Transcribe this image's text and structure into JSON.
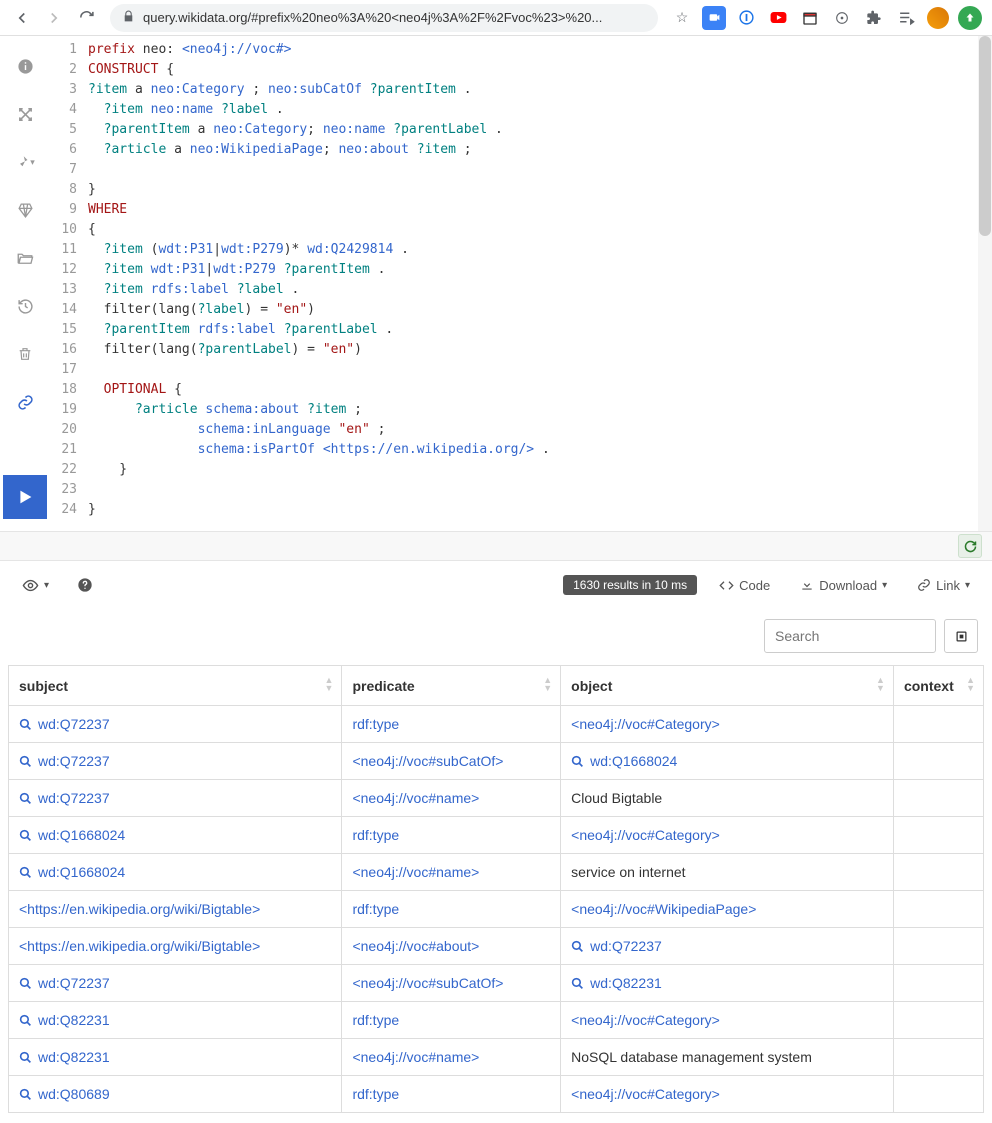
{
  "browser": {
    "url": "query.wikidata.org/#prefix%20neo%3A%20<neo4j%3A%2F%2Fvoc%23>%20..."
  },
  "editor": {
    "lines": [
      {
        "n": 1,
        "tokens": [
          [
            "kw",
            "prefix "
          ],
          [
            "plain",
            "neo: "
          ],
          [
            "uri",
            "<neo4j://voc#>"
          ]
        ]
      },
      {
        "n": 2,
        "tokens": [
          [
            "kw",
            "CONSTRUCT"
          ],
          [
            "plain",
            " {"
          ]
        ]
      },
      {
        "n": 3,
        "tokens": [
          [
            "var",
            "?item"
          ],
          [
            "plain",
            " a "
          ],
          [
            "uri",
            "neo:Category"
          ],
          [
            "plain",
            " ; "
          ],
          [
            "uri",
            "neo:subCatOf"
          ],
          [
            "plain",
            " "
          ],
          [
            "var",
            "?parentItem"
          ],
          [
            "plain",
            " ."
          ]
        ]
      },
      {
        "n": 4,
        "tokens": [
          [
            "plain",
            "  "
          ],
          [
            "var",
            "?item"
          ],
          [
            "plain",
            " "
          ],
          [
            "uri",
            "neo:name"
          ],
          [
            "plain",
            " "
          ],
          [
            "var",
            "?label"
          ],
          [
            "plain",
            " ."
          ]
        ]
      },
      {
        "n": 5,
        "tokens": [
          [
            "plain",
            "  "
          ],
          [
            "var",
            "?parentItem"
          ],
          [
            "plain",
            " a "
          ],
          [
            "uri",
            "neo:Category"
          ],
          [
            "plain",
            "; "
          ],
          [
            "uri",
            "neo:name"
          ],
          [
            "plain",
            " "
          ],
          [
            "var",
            "?parentLabel"
          ],
          [
            "plain",
            " ."
          ]
        ]
      },
      {
        "n": 6,
        "tokens": [
          [
            "plain",
            "  "
          ],
          [
            "var",
            "?article"
          ],
          [
            "plain",
            " a "
          ],
          [
            "uri",
            "neo:WikipediaPage"
          ],
          [
            "plain",
            "; "
          ],
          [
            "uri",
            "neo:about"
          ],
          [
            "plain",
            " "
          ],
          [
            "var",
            "?item"
          ],
          [
            "plain",
            " ;"
          ]
        ]
      },
      {
        "n": 7,
        "tokens": [
          [
            "plain",
            ""
          ]
        ]
      },
      {
        "n": 8,
        "tokens": [
          [
            "plain",
            "}"
          ]
        ]
      },
      {
        "n": 9,
        "tokens": [
          [
            "kw",
            "WHERE"
          ]
        ]
      },
      {
        "n": 10,
        "tokens": [
          [
            "plain",
            "{"
          ]
        ]
      },
      {
        "n": 11,
        "tokens": [
          [
            "plain",
            "  "
          ],
          [
            "var",
            "?item"
          ],
          [
            "plain",
            " ("
          ],
          [
            "uri",
            "wdt:P31"
          ],
          [
            "plain",
            "|"
          ],
          [
            "uri",
            "wdt:P279"
          ],
          [
            "plain",
            ")* "
          ],
          [
            "uri",
            "wd:Q2429814"
          ],
          [
            "plain",
            " ."
          ]
        ]
      },
      {
        "n": 12,
        "tokens": [
          [
            "plain",
            "  "
          ],
          [
            "var",
            "?item"
          ],
          [
            "plain",
            " "
          ],
          [
            "uri",
            "wdt:P31"
          ],
          [
            "plain",
            "|"
          ],
          [
            "uri",
            "wdt:P279"
          ],
          [
            "plain",
            " "
          ],
          [
            "var",
            "?parentItem"
          ],
          [
            "plain",
            " ."
          ]
        ]
      },
      {
        "n": 13,
        "tokens": [
          [
            "plain",
            "  "
          ],
          [
            "var",
            "?item"
          ],
          [
            "plain",
            " "
          ],
          [
            "uri",
            "rdfs:label"
          ],
          [
            "plain",
            " "
          ],
          [
            "var",
            "?label"
          ],
          [
            "plain",
            " ."
          ]
        ]
      },
      {
        "n": 14,
        "tokens": [
          [
            "plain",
            "  filter(lang("
          ],
          [
            "var",
            "?label"
          ],
          [
            "plain",
            ") = "
          ],
          [
            "str",
            "\"en\""
          ],
          [
            "plain",
            ")"
          ]
        ]
      },
      {
        "n": 15,
        "tokens": [
          [
            "plain",
            "  "
          ],
          [
            "var",
            "?parentItem"
          ],
          [
            "plain",
            " "
          ],
          [
            "uri",
            "rdfs:label"
          ],
          [
            "plain",
            " "
          ],
          [
            "var",
            "?parentLabel"
          ],
          [
            "plain",
            " ."
          ]
        ]
      },
      {
        "n": 16,
        "tokens": [
          [
            "plain",
            "  filter(lang("
          ],
          [
            "var",
            "?parentLabel"
          ],
          [
            "plain",
            ") = "
          ],
          [
            "str",
            "\"en\""
          ],
          [
            "plain",
            ")"
          ]
        ]
      },
      {
        "n": 17,
        "tokens": [
          [
            "plain",
            ""
          ]
        ]
      },
      {
        "n": 18,
        "tokens": [
          [
            "plain",
            "  "
          ],
          [
            "kw",
            "OPTIONAL"
          ],
          [
            "plain",
            " {"
          ]
        ]
      },
      {
        "n": 19,
        "tokens": [
          [
            "plain",
            "      "
          ],
          [
            "var",
            "?article"
          ],
          [
            "plain",
            " "
          ],
          [
            "uri",
            "schema:about"
          ],
          [
            "plain",
            " "
          ],
          [
            "var",
            "?item"
          ],
          [
            "plain",
            " ;"
          ]
        ]
      },
      {
        "n": 20,
        "tokens": [
          [
            "plain",
            "              "
          ],
          [
            "uri",
            "schema:inLanguage"
          ],
          [
            "plain",
            " "
          ],
          [
            "str",
            "\"en\""
          ],
          [
            "plain",
            " ;"
          ]
        ]
      },
      {
        "n": 21,
        "tokens": [
          [
            "plain",
            "              "
          ],
          [
            "uri",
            "schema:isPartOf"
          ],
          [
            "plain",
            " "
          ],
          [
            "uri",
            "<https://en.wikipedia.org/>"
          ],
          [
            "plain",
            " ."
          ]
        ]
      },
      {
        "n": 22,
        "tokens": [
          [
            "plain",
            "    }"
          ]
        ]
      },
      {
        "n": 23,
        "tokens": [
          [
            "plain",
            ""
          ]
        ]
      },
      {
        "n": 24,
        "tokens": [
          [
            "plain",
            "}"
          ]
        ]
      }
    ]
  },
  "toolbar": {
    "results_pill": "1630 results in 10 ms",
    "code_label": "Code",
    "download_label": "Download",
    "link_label": "Link",
    "search_placeholder": "Search"
  },
  "table": {
    "headers": [
      "subject",
      "predicate",
      "object",
      "context"
    ],
    "rows": [
      {
        "subject": {
          "t": "q",
          "v": "wd:Q72237"
        },
        "predicate": {
          "t": "l",
          "v": "rdf:type"
        },
        "object": {
          "t": "l",
          "v": "<neo4j://voc#Category>"
        },
        "context": ""
      },
      {
        "subject": {
          "t": "q",
          "v": "wd:Q72237"
        },
        "predicate": {
          "t": "l",
          "v": "<neo4j://voc#subCatOf>"
        },
        "object": {
          "t": "q",
          "v": "wd:Q1668024"
        },
        "context": ""
      },
      {
        "subject": {
          "t": "q",
          "v": "wd:Q72237"
        },
        "predicate": {
          "t": "l",
          "v": "<neo4j://voc#name>"
        },
        "object": {
          "t": "p",
          "v": "Cloud Bigtable"
        },
        "context": ""
      },
      {
        "subject": {
          "t": "q",
          "v": "wd:Q1668024"
        },
        "predicate": {
          "t": "l",
          "v": "rdf:type"
        },
        "object": {
          "t": "l",
          "v": "<neo4j://voc#Category>"
        },
        "context": ""
      },
      {
        "subject": {
          "t": "q",
          "v": "wd:Q1668024"
        },
        "predicate": {
          "t": "l",
          "v": "<neo4j://voc#name>"
        },
        "object": {
          "t": "p",
          "v": "service on internet"
        },
        "context": ""
      },
      {
        "subject": {
          "t": "l",
          "v": "<https://en.wikipedia.org/wiki/Bigtable>"
        },
        "predicate": {
          "t": "l",
          "v": "rdf:type"
        },
        "object": {
          "t": "l",
          "v": "<neo4j://voc#WikipediaPage>"
        },
        "context": ""
      },
      {
        "subject": {
          "t": "l",
          "v": "<https://en.wikipedia.org/wiki/Bigtable>"
        },
        "predicate": {
          "t": "l",
          "v": "<neo4j://voc#about>"
        },
        "object": {
          "t": "q",
          "v": "wd:Q72237"
        },
        "context": ""
      },
      {
        "subject": {
          "t": "q",
          "v": "wd:Q72237"
        },
        "predicate": {
          "t": "l",
          "v": "<neo4j://voc#subCatOf>"
        },
        "object": {
          "t": "q",
          "v": "wd:Q82231"
        },
        "context": ""
      },
      {
        "subject": {
          "t": "q",
          "v": "wd:Q82231"
        },
        "predicate": {
          "t": "l",
          "v": "rdf:type"
        },
        "object": {
          "t": "l",
          "v": "<neo4j://voc#Category>"
        },
        "context": ""
      },
      {
        "subject": {
          "t": "q",
          "v": "wd:Q82231"
        },
        "predicate": {
          "t": "l",
          "v": "<neo4j://voc#name>"
        },
        "object": {
          "t": "p",
          "v": "NoSQL database management system"
        },
        "context": ""
      },
      {
        "subject": {
          "t": "q",
          "v": "wd:Q80689"
        },
        "predicate": {
          "t": "l",
          "v": "rdf:type"
        },
        "object": {
          "t": "l",
          "v": "<neo4j://voc#Category>"
        },
        "context": ""
      }
    ]
  }
}
